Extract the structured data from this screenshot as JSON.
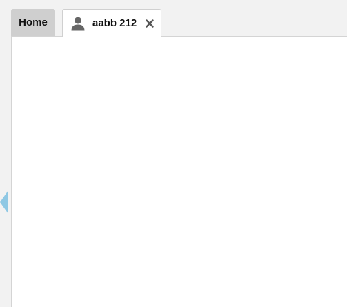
{
  "tabs": [
    {
      "label": "Home",
      "active": false
    },
    {
      "label": "aabb 212",
      "active": true,
      "icon": "user-icon",
      "closable": true
    }
  ],
  "colors": {
    "background": "#f2f2f2",
    "inactive_tab": "#cfcfcf",
    "active_tab": "#ffffff",
    "icon": "#666666",
    "toggle": "#8fc8e4"
  },
  "sidebar_toggle": {
    "icon": "triangle-left-icon"
  }
}
